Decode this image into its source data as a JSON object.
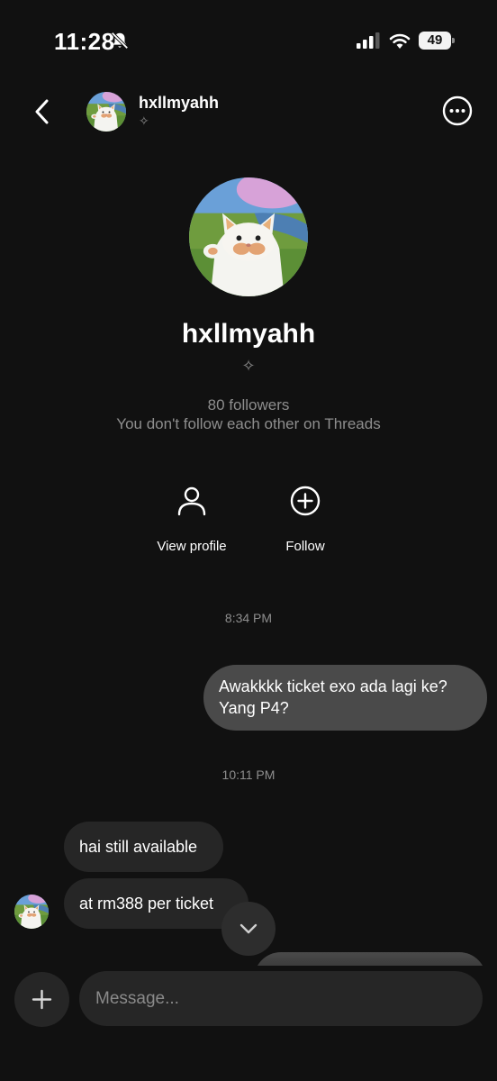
{
  "status_bar": {
    "time": "11:28",
    "battery": "49",
    "icons": [
      "bell-slash-icon",
      "cellular-signal-icon",
      "wifi-icon",
      "battery-icon"
    ]
  },
  "header": {
    "username": "hxllmyahh",
    "sparkle": "✧",
    "icons": [
      "back-chevron-icon",
      "more-options-icon"
    ]
  },
  "profile": {
    "name": "hxllmyahh",
    "sparkle": "✧",
    "followers": "80 followers",
    "follow_note": "You don't follow each other on Threads",
    "actions": [
      {
        "label": "View profile",
        "icon": "person-icon"
      },
      {
        "label": "Follow",
        "icon": "plus-circle-icon"
      }
    ]
  },
  "messages": [
    {
      "timestamp": "8:34 PM"
    },
    {
      "direction": "outgoing",
      "text": "Awakkkk ticket exo ada lagi ke? Yang P4?"
    },
    {
      "timestamp": "10:11 PM"
    },
    {
      "direction": "incoming",
      "text": "hai still available"
    },
    {
      "direction": "incoming",
      "text": "at rm388 per ticket"
    }
  ],
  "composer": {
    "placeholder": "Message...",
    "icons": [
      "plus-icon",
      "chevron-down-icon"
    ]
  },
  "colors": {
    "background": "#111111",
    "incoming_bubble": "#262626",
    "outgoing_bubble": "#4a4a4a",
    "muted_text": "#8e8e8e"
  }
}
